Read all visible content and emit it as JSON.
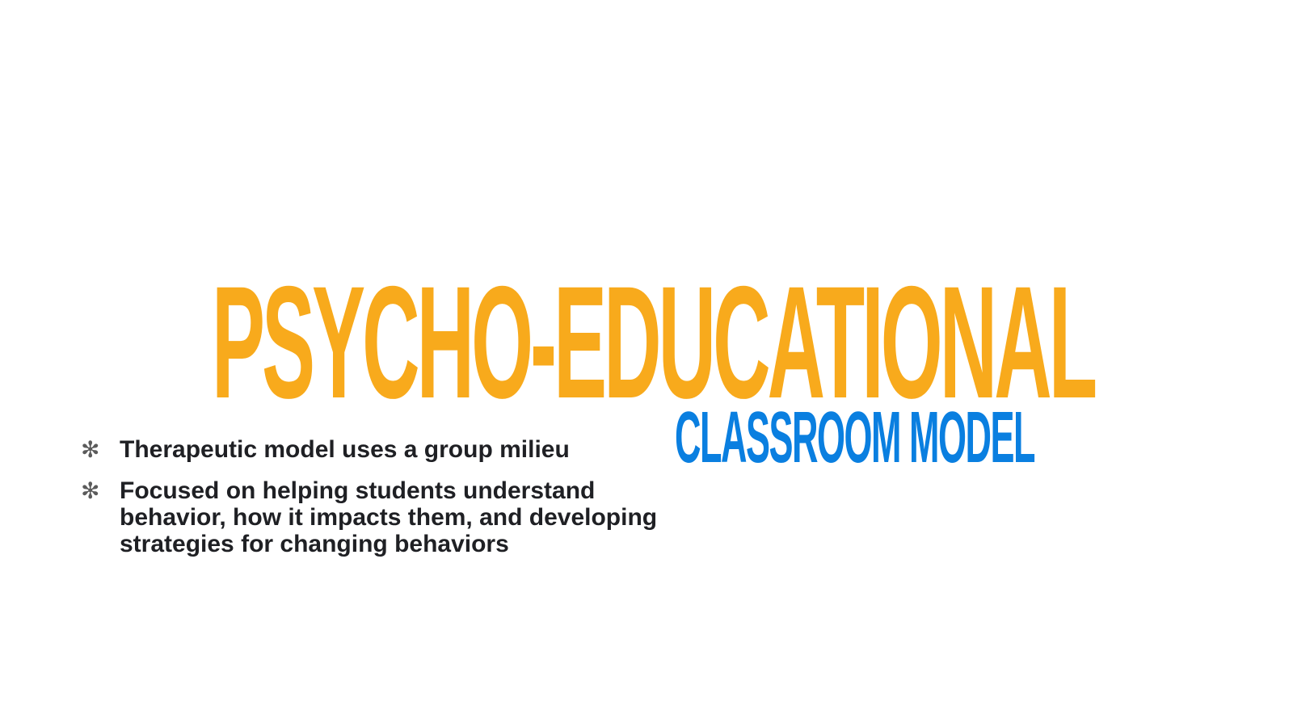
{
  "slide": {
    "title": "PSYCHO-EDUCATIONAL",
    "subtitle": "CLASSROOM MODEL",
    "bullets": [
      {
        "icon": "asterisk-bullet-icon",
        "text": "Therapeutic model uses a group milieu"
      },
      {
        "icon": "asterisk-bullet-icon",
        "text": "Focused on helping students understand behavior, how it impacts them, and developing strategies for changing behaviors"
      }
    ]
  },
  "colors": {
    "title": "#F8AA1C",
    "subtitle": "#0A7FE0",
    "body_text": "#1F2024",
    "bullet_icon": "#5B5B5B",
    "background": "#FFFFFF"
  }
}
